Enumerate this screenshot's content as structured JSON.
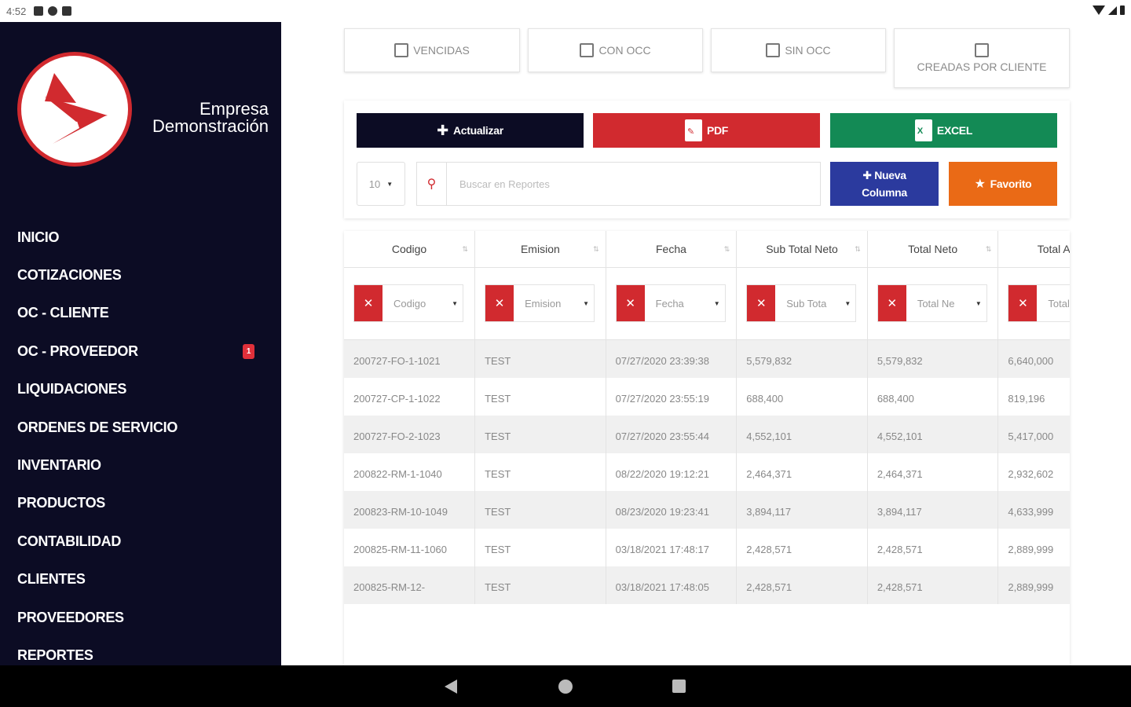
{
  "status_bar": {
    "time": "4:52"
  },
  "brand": {
    "line1": "Empresa",
    "line2": "Demonstración"
  },
  "sidebar": {
    "items": [
      {
        "label": "INICIO"
      },
      {
        "label": "COTIZACIONES"
      },
      {
        "label": "OC - CLIENTE"
      },
      {
        "label": "OC - PROVEEDOR",
        "badge": "1"
      },
      {
        "label": "LIQUIDACIONES"
      },
      {
        "label": "ORDENES DE SERVICIO"
      },
      {
        "label": "INVENTARIO"
      },
      {
        "label": "PRODUCTOS"
      },
      {
        "label": "CONTABILIDAD"
      },
      {
        "label": "CLIENTES"
      },
      {
        "label": "PROVEEDORES"
      },
      {
        "label": "REPORTES"
      }
    ]
  },
  "filters": {
    "vencidas": "VENCIDAS",
    "con_occ": "CON OCC",
    "sin_occ": "SIN OCC",
    "creadas": "CREADAS POR CLIENTE"
  },
  "toolbar": {
    "actualizar": "Actualizar",
    "pdf": "PDF",
    "excel": "EXCEL",
    "nueva_line1": "Nueva",
    "nueva_line2": "Columna",
    "favorito": "Favorito",
    "page_size": "10",
    "search_placeholder": "Buscar en Reportes"
  },
  "colors": {
    "primary": "#0c0c24",
    "pdf": "#d12a2f",
    "excel": "#138a55",
    "nueva": "#2b3a9e",
    "favorito": "#ea6a16"
  },
  "table": {
    "columns": [
      "Codigo",
      "Emision",
      "Fecha",
      "Sub Total Neto",
      "Total Neto",
      "Total APag"
    ],
    "filter_placeholders": [
      "Codigo",
      "Emision",
      "Fecha",
      "Sub Tota",
      "Total Ne",
      "Total A"
    ],
    "rows": [
      [
        "200727-FO-1-1021",
        "TEST",
        "07/27/2020 23:39:38",
        "5,579,832",
        "5,579,832",
        "6,640,000"
      ],
      [
        "200727-CP-1-1022",
        "TEST",
        "07/27/2020 23:55:19",
        "688,400",
        "688,400",
        "819,196"
      ],
      [
        "200727-FO-2-1023",
        "TEST",
        "07/27/2020 23:55:44",
        "4,552,101",
        "4,552,101",
        "5,417,000"
      ],
      [
        "200822-RM-1-1040",
        "TEST",
        "08/22/2020 19:12:21",
        "2,464,371",
        "2,464,371",
        "2,932,602"
      ],
      [
        "200823-RM-10-1049",
        "TEST",
        "08/23/2020 19:23:41",
        "3,894,117",
        "3,894,117",
        "4,633,999"
      ],
      [
        "200825-RM-11-1060",
        "TEST",
        "03/18/2021 17:48:17",
        "2,428,571",
        "2,428,571",
        "2,889,999"
      ],
      [
        "200825-RM-12-",
        "TEST",
        "03/18/2021 17:48:05",
        "2,428,571",
        "2,428,571",
        "2,889,999"
      ]
    ]
  }
}
